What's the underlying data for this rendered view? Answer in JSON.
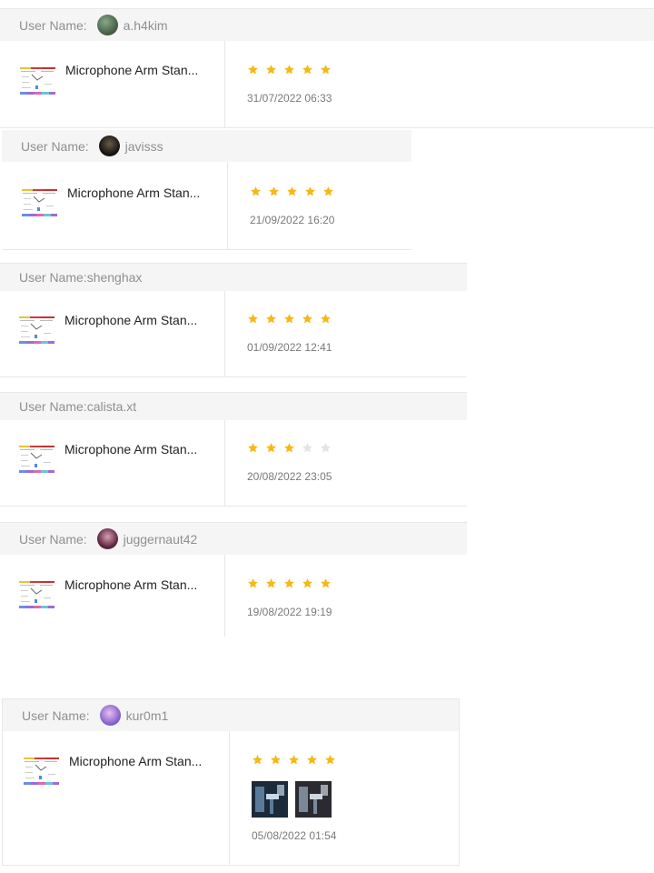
{
  "reviews": [
    {
      "header": "User Name: ",
      "username": "a.h4kim",
      "product": "Microphone Arm Stan...",
      "rating": 5,
      "date": "31/07/2022 06:33",
      "has_avatar": true,
      "avatar_color": "#4e6b4f"
    },
    {
      "header": "User Name: ",
      "username": "javisss",
      "product": "Microphone Arm Stan...",
      "rating": 5,
      "date": "21/09/2022 16:20",
      "has_avatar": true,
      "avatar_color": "#2a2a2a"
    },
    {
      "header": "User Name:",
      "username": "shenghax",
      "product": "Microphone Arm Stan...",
      "rating": 5,
      "date": "01/09/2022 12:41",
      "has_avatar": false
    },
    {
      "header": "User Name:",
      "username": "calista.xt",
      "product": "Microphone Arm Stan...",
      "rating": 3,
      "date": "20/08/2022 23:05",
      "has_avatar": false
    },
    {
      "header": "User Name: ",
      "username": "juggernaut42",
      "product": "Microphone Arm Stan...",
      "rating": 5,
      "date": "19/08/2022 19:19",
      "has_avatar": true,
      "avatar_color": "#7a3b55"
    },
    {
      "header": "User Name: ",
      "username": "kur0m1",
      "product": "Microphone Arm Stan...",
      "rating": 5,
      "date": "05/08/2022 01:54",
      "has_avatar": true,
      "avatar_color": "#a57bd6",
      "review_images": 2
    }
  ],
  "colors": {
    "star_filled": "#f5b917",
    "star_empty": "#e4e4e4",
    "header_bg": "#f5f5f5"
  }
}
